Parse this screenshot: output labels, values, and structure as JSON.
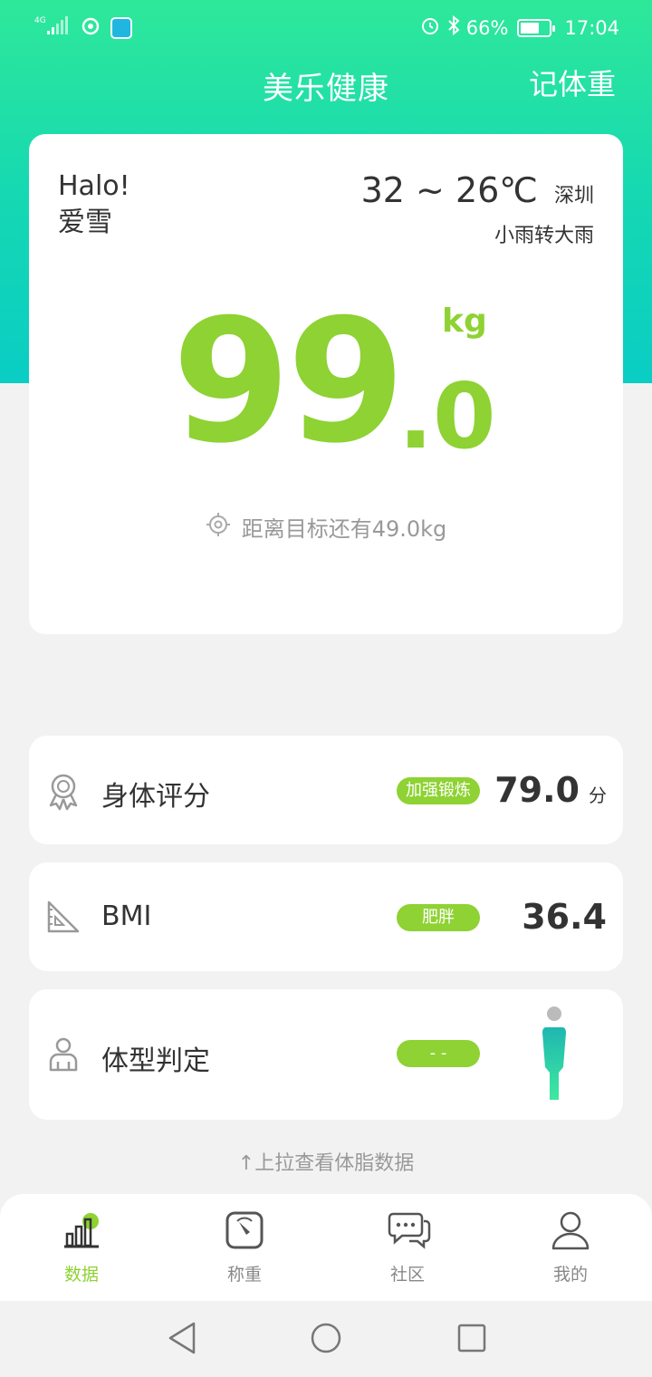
{
  "status_bar": {
    "network": "4G",
    "battery_percent": "66%",
    "time": "17:04",
    "battery_level": 0.66
  },
  "header": {
    "title": "美乐健康",
    "action": "记体重"
  },
  "greeting": {
    "hello": "Halo!",
    "name": "爱雪"
  },
  "weather": {
    "temp_range": "32 ~ 26℃",
    "city": "深圳",
    "condition": "小雨转大雨"
  },
  "weight": {
    "integer": "99",
    "decimal": ".0",
    "unit": "kg",
    "goal_text": "距离目标还有49.0kg"
  },
  "metrics": {
    "score": {
      "label": "身体评分",
      "badge": "加强锻炼",
      "value": "79.0",
      "unit": "分"
    },
    "bmi": {
      "label": "BMI",
      "badge": "肥胖",
      "value": "36.4"
    },
    "body_type": {
      "label": "体型判定",
      "badge": "- -"
    }
  },
  "pull_hint": "↑上拉查看体脂数据",
  "nav": {
    "items": [
      {
        "label": "数据",
        "icon": "bar-chart-icon",
        "active": true
      },
      {
        "label": "称重",
        "icon": "scale-icon",
        "active": false
      },
      {
        "label": "社区",
        "icon": "chat-bubbles-icon",
        "active": false
      },
      {
        "label": "我的",
        "icon": "person-icon",
        "active": false
      }
    ]
  },
  "colors": {
    "accent_green": "#8ed233",
    "header_gradient_top": "#2ee89a",
    "header_gradient_bottom": "#0acdc4",
    "background": "#f2f2f2"
  }
}
